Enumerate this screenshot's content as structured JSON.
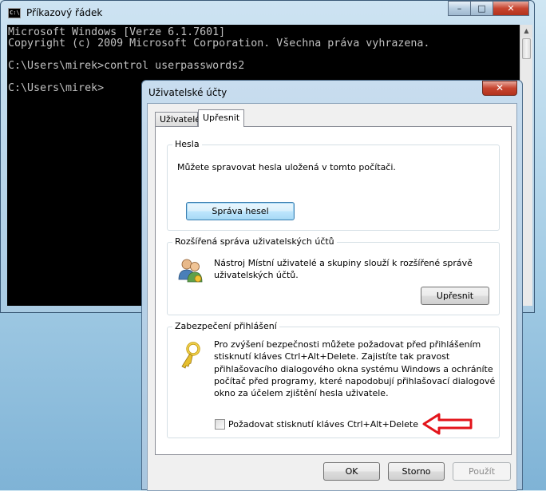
{
  "cmd": {
    "title": "Příkazový řádek",
    "icon_text": "C:\\",
    "lines": [
      "Microsoft Windows [Verze 6.1.7601]",
      "Copyright (c) 2009 Microsoft Corporation. Všechna práva vyhrazena.",
      "",
      "C:\\Users\\mirek>control userpasswords2",
      "",
      "C:\\Users\\mirek>"
    ],
    "controls": {
      "minimize": "–",
      "maximize": "□",
      "close": "✕"
    }
  },
  "dialog": {
    "title": "Uživatelské účty",
    "close": "✕",
    "tabs": [
      "Uživatelé",
      "Upřesnit"
    ],
    "active_tab": "Upřesnit",
    "passwords": {
      "legend": "Hesla",
      "text": "Můžete spravovat hesla uložená v tomto počítači.",
      "button": "Správa hesel"
    },
    "advanced": {
      "legend": "Rozšířená správa uživatelských účtů",
      "text_line1": "Nástroj Místní uživatelé a skupiny slouží k rozšířené správě",
      "text_line2": "uživatelských účtů.",
      "button": "Upřesnit"
    },
    "security": {
      "legend": "Zabezpečení přihlášení",
      "text_lines": [
        "Pro zvýšení bezpečnosti můžete požadovat před přihlášením",
        "stisknutí kláves Ctrl+Alt+Delete. Zajistíte tak pravost",
        "přihlašovacího dialogového okna systému Windows a ochráníte",
        "počítač před programy, které napodobují přihlašovací dialogové",
        "okno za účelem zjištění hesla uživatele."
      ],
      "checkbox_label": "Požadovat stisknutí kláves Ctrl+Alt+Delete",
      "checkbox_checked": false
    },
    "buttons": {
      "ok": "OK",
      "cancel": "Storno",
      "apply": "Použít"
    }
  },
  "colors": {
    "arrow": "#e3141b"
  }
}
